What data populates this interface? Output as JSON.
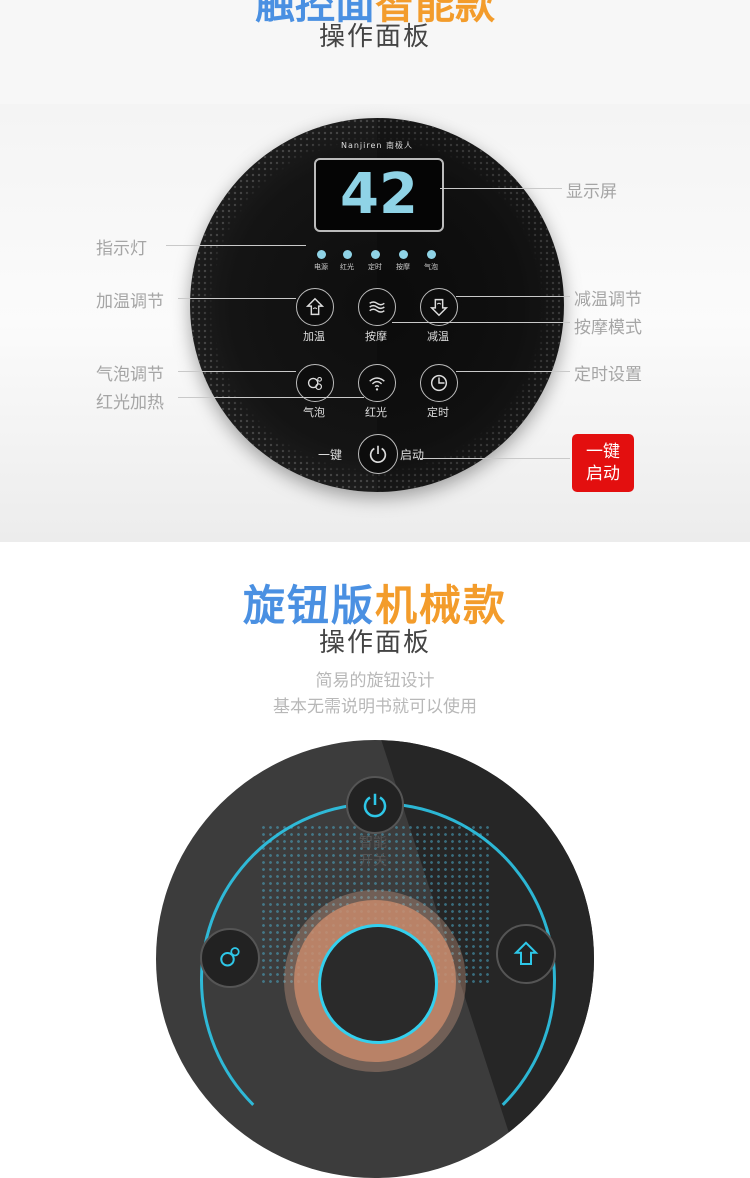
{
  "top": {
    "title_cut_blue": "触控面",
    "title_cut_orange": "智能款",
    "subtitle": "操作面板"
  },
  "panel": {
    "brand": "Nanjiren 南极人",
    "display_value": "42",
    "indicators": [
      "电源",
      "红光",
      "定时",
      "按摩",
      "气泡"
    ],
    "buttons": {
      "heat_up": "加温",
      "massage": "按摩",
      "heat_down": "减温",
      "bubble": "气泡",
      "red_light": "红光",
      "timer": "定时"
    },
    "power_left": "一键",
    "power_right": "启动",
    "accent_color": "#8fd3e6"
  },
  "callouts": {
    "display": "显示屏",
    "indicator": "指示灯",
    "heat_up": "加温调节",
    "heat_down": "减温调节",
    "massage_mode": "按摩模式",
    "bubble": "气泡调节",
    "red_light": "红光加热",
    "timer": "定时设置"
  },
  "badge": {
    "line1": "一键",
    "line2": "启动",
    "color": "#e30f0f"
  },
  "knob": {
    "title_blue": "旋钮版",
    "title_orange": "机械款",
    "subtitle": "操作面板",
    "desc1": "简易的旋钮设计",
    "desc2": "基本无需说明书就可以使用",
    "power_label_l1": "智能",
    "power_label_l2": "开关",
    "accent_color": "#2ec7e8"
  }
}
